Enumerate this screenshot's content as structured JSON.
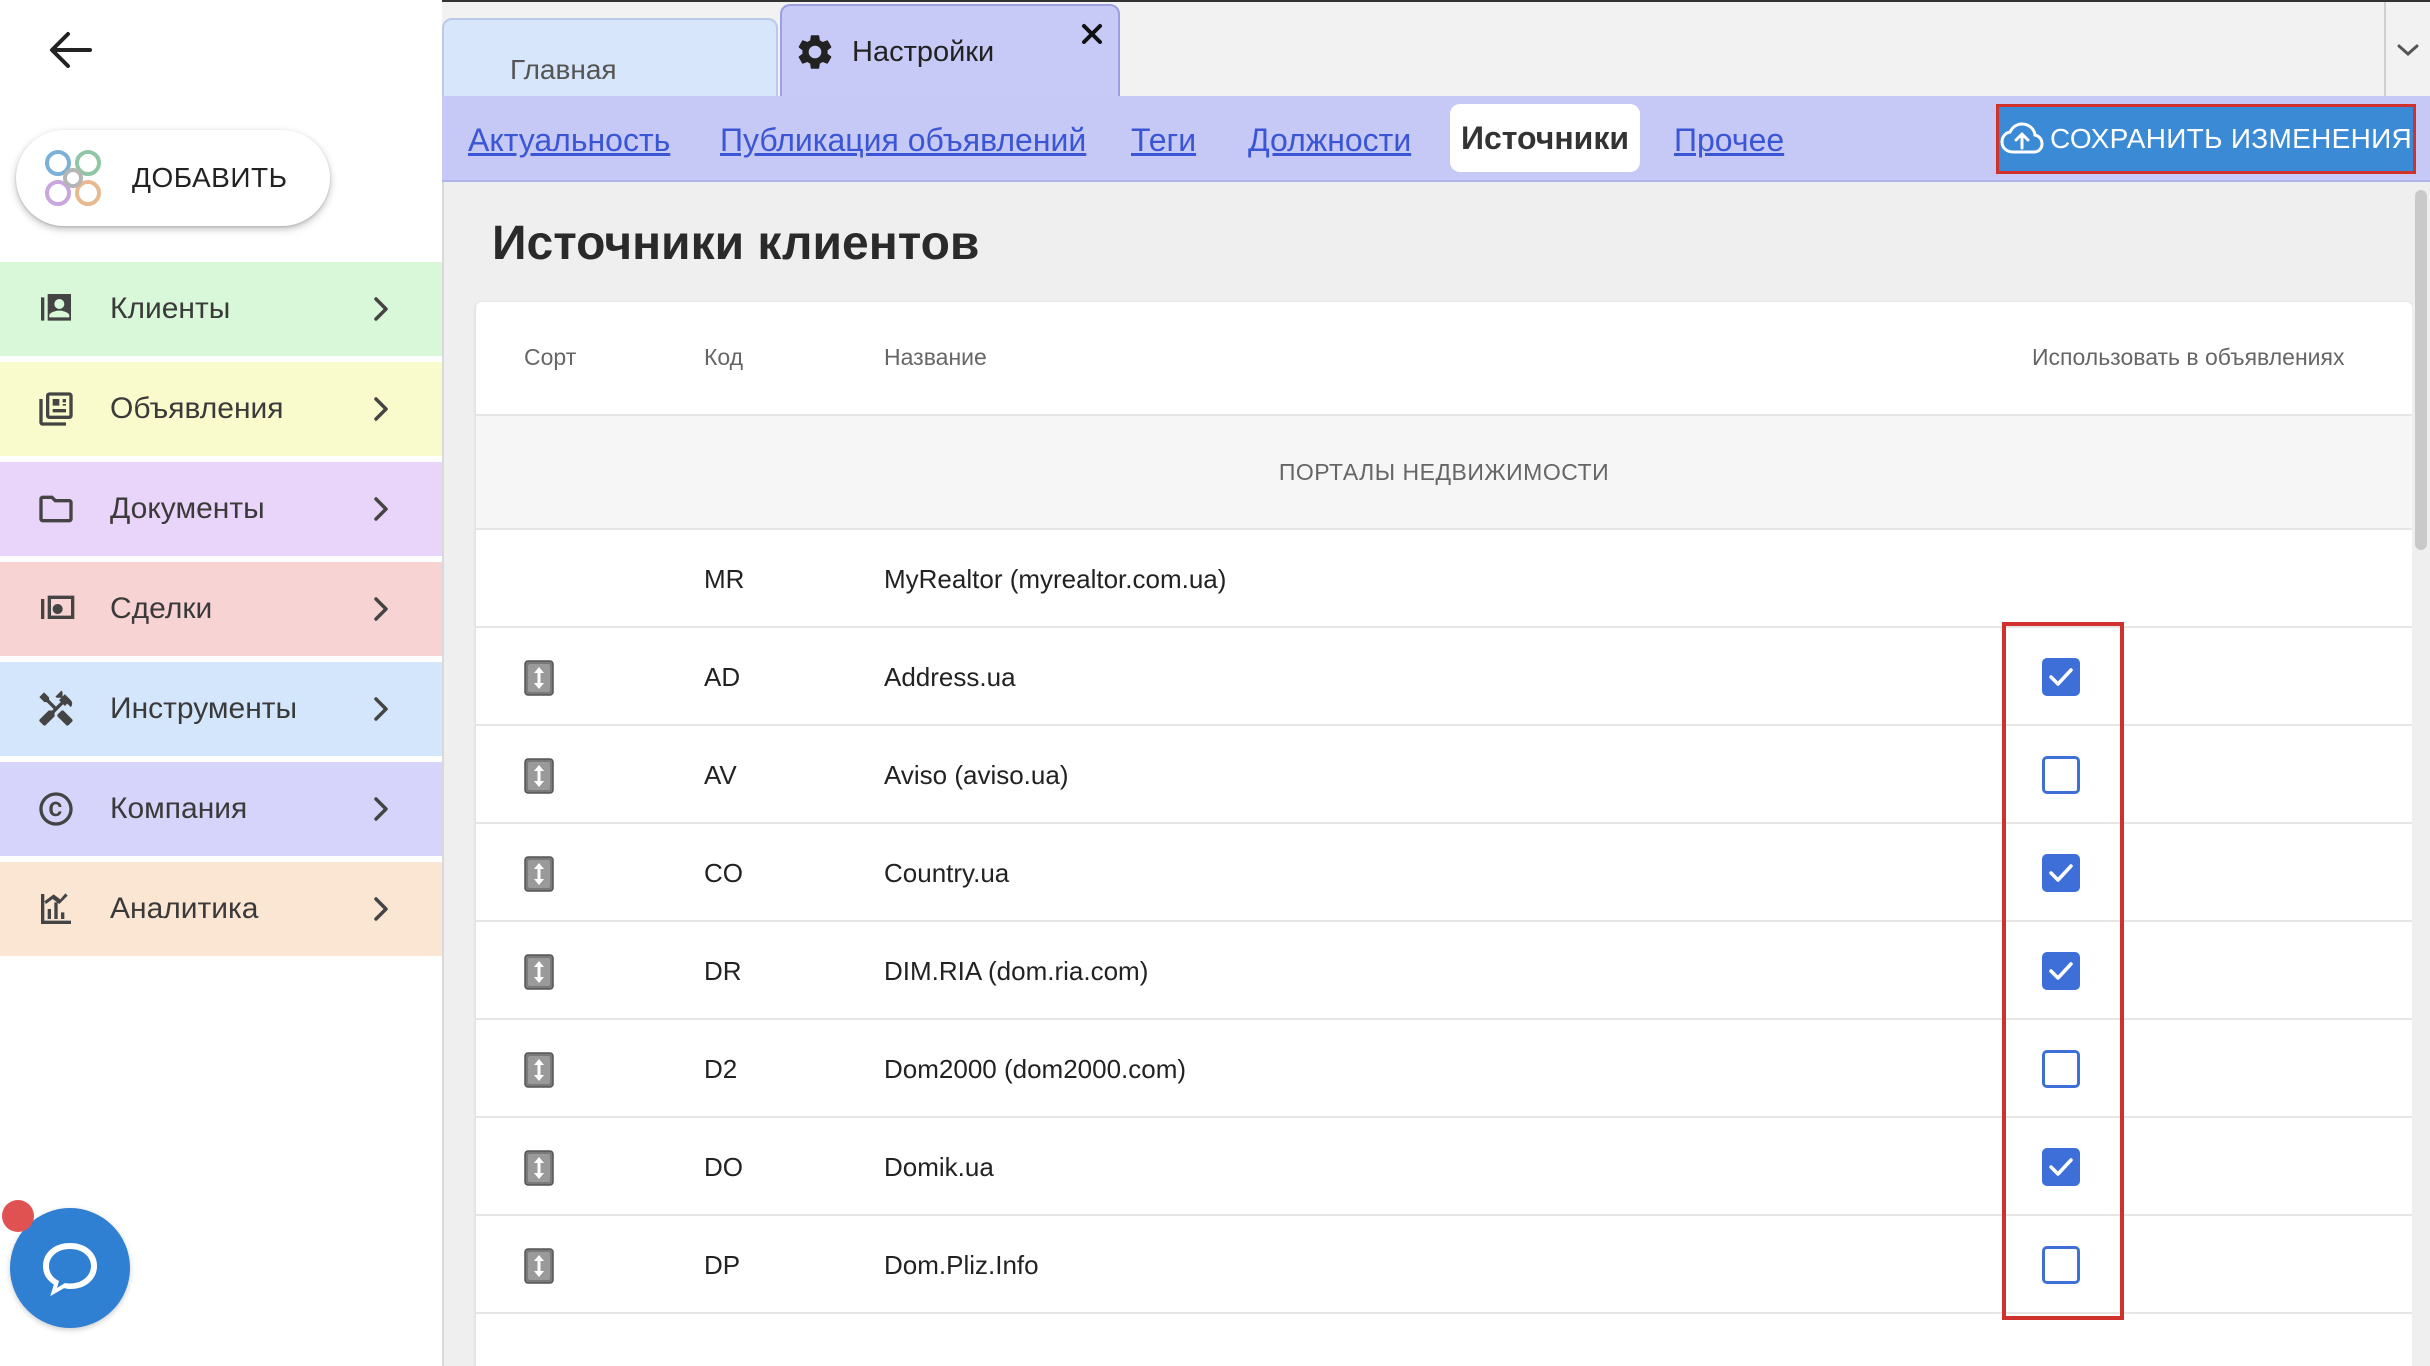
{
  "sidebar": {
    "add_label": "ДОБАВИТЬ",
    "items": [
      {
        "label": "Клиенты",
        "icon": "contacts-icon",
        "bg": "#d9f7d9"
      },
      {
        "label": "Объявления",
        "icon": "listing-icon",
        "bg": "#fafbcd"
      },
      {
        "label": "Документы",
        "icon": "folder-icon",
        "bg": "#e9d4fa"
      },
      {
        "label": "Сделки",
        "icon": "money-icon",
        "bg": "#f8d3d4"
      },
      {
        "label": "Инструменты",
        "icon": "tools-icon",
        "bg": "#d4e6fb"
      },
      {
        "label": "Компания",
        "icon": "copyright-icon",
        "bg": "#d6d4fa"
      },
      {
        "label": "Аналитика",
        "icon": "analytics-icon",
        "bg": "#fbe6d4"
      }
    ]
  },
  "tabs": {
    "home": "Главная",
    "settings": "Настройки"
  },
  "subnav": {
    "links": [
      "Актуальность",
      "Публикация объявлений",
      "Теги",
      "Должности"
    ],
    "active": "Источники",
    "other": "Прочее",
    "save_label": "СОХРАНИТЬ ИЗМЕНЕНИЯ"
  },
  "page": {
    "title": "Источники клиентов"
  },
  "table": {
    "headers": {
      "sort": "Сорт",
      "code": "Код",
      "name": "Название",
      "use": "Использовать в объявлениях"
    },
    "group": "ПОРТАЛЫ НЕДВИЖИМОСТИ",
    "rows": [
      {
        "code": "MR",
        "name": "MyRealtor (myrealtor.com.ua)",
        "sortable": false,
        "has_checkbox": false,
        "checked": false
      },
      {
        "code": "AD",
        "name": "Address.ua",
        "sortable": true,
        "has_checkbox": true,
        "checked": true
      },
      {
        "code": "AV",
        "name": "Aviso (aviso.ua)",
        "sortable": true,
        "has_checkbox": true,
        "checked": false
      },
      {
        "code": "CO",
        "name": "Country.ua",
        "sortable": true,
        "has_checkbox": true,
        "checked": true
      },
      {
        "code": "DR",
        "name": "DIM.RIA (dom.ria.com)",
        "sortable": true,
        "has_checkbox": true,
        "checked": true
      },
      {
        "code": "D2",
        "name": "Dom2000 (dom2000.com)",
        "sortable": true,
        "has_checkbox": true,
        "checked": false
      },
      {
        "code": "DO",
        "name": "Domik.ua",
        "sortable": true,
        "has_checkbox": true,
        "checked": true
      },
      {
        "code": "DP",
        "name": "Dom.Pliz.Info",
        "sortable": true,
        "has_checkbox": true,
        "checked": false
      }
    ]
  },
  "colors": {
    "accent": "#3a8ad6",
    "checkbox": "#3e6fd8",
    "highlight": "#d0312d",
    "subnav_bg": "#c6c8f6"
  }
}
